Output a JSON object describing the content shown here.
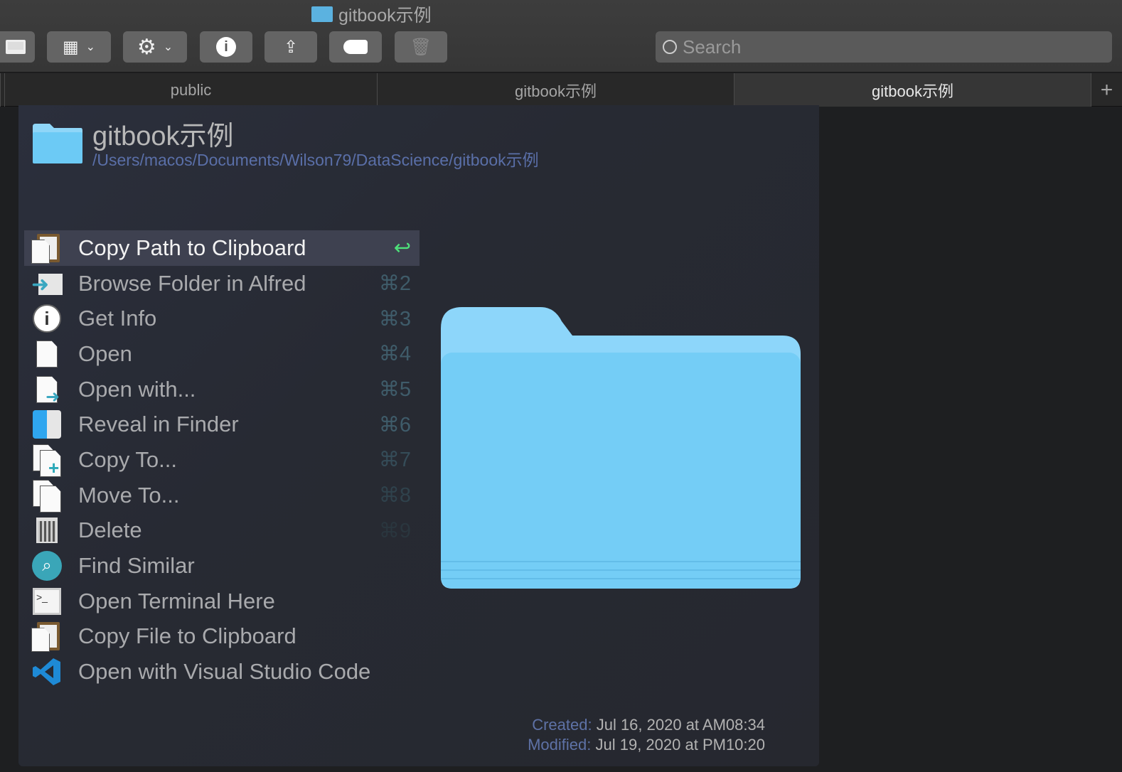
{
  "window": {
    "title": "gitbook示例"
  },
  "toolbar": {
    "buttons": [
      {
        "name": "view-toggle",
        "icon": "screen-icon"
      },
      {
        "name": "view-mode",
        "icon": "grid-icon",
        "dropdown": true
      },
      {
        "name": "action",
        "icon": "gear-icon",
        "dropdown": true
      },
      {
        "name": "get-info",
        "icon": "info-icon"
      },
      {
        "name": "share",
        "icon": "share-icon"
      },
      {
        "name": "tag",
        "icon": "tag-icon"
      },
      {
        "name": "delete",
        "icon": "trash-icon"
      }
    ],
    "search_placeholder": "Search"
  },
  "tabs": [
    {
      "label": "public"
    },
    {
      "label": "gitbook示例"
    },
    {
      "label": "gitbook示例",
      "active": true
    }
  ],
  "alfred": {
    "title": "gitbook示例",
    "path": "/Users/macos/Documents/Wilson79/DataScience/gitbook示例",
    "actions": [
      {
        "label": "Copy Path to Clipboard",
        "shortcut": "↩",
        "icon": "clipboard-icon",
        "selected": true
      },
      {
        "label": "Browse Folder in Alfred",
        "shortcut": "⌘2",
        "icon": "browse-folder-icon"
      },
      {
        "label": "Get Info",
        "shortcut": "⌘3",
        "icon": "info-icon"
      },
      {
        "label": "Open",
        "shortcut": "⌘4",
        "icon": "document-icon"
      },
      {
        "label": "Open with...",
        "shortcut": "⌘5",
        "icon": "open-with-icon"
      },
      {
        "label": "Reveal in Finder",
        "shortcut": "⌘6",
        "icon": "finder-icon"
      },
      {
        "label": "Copy To...",
        "shortcut": "⌘7",
        "icon": "copy-to-icon"
      },
      {
        "label": "Move To...",
        "shortcut": "⌘8",
        "icon": "move-to-icon"
      },
      {
        "label": "Delete",
        "shortcut": "⌘9",
        "icon": "trash-icon"
      },
      {
        "label": "Find Similar",
        "shortcut": "",
        "icon": "magnifier-icon"
      },
      {
        "label": "Open Terminal Here",
        "shortcut": "",
        "icon": "terminal-icon"
      },
      {
        "label": "Copy File to Clipboard",
        "shortcut": "",
        "icon": "clipboard-icon"
      },
      {
        "label": "Open with Visual Studio Code",
        "shortcut": "",
        "icon": "vscode-icon"
      }
    ],
    "created_label": "Created:",
    "created": "Jul 16, 2020 at AM08:34",
    "modified_label": "Modified:",
    "modified": "Jul 19, 2020 at PM10:20"
  },
  "colors": {
    "accent_return": "#4ee07a",
    "path": "#5a6fa8",
    "folder": "#6ccaf5"
  }
}
